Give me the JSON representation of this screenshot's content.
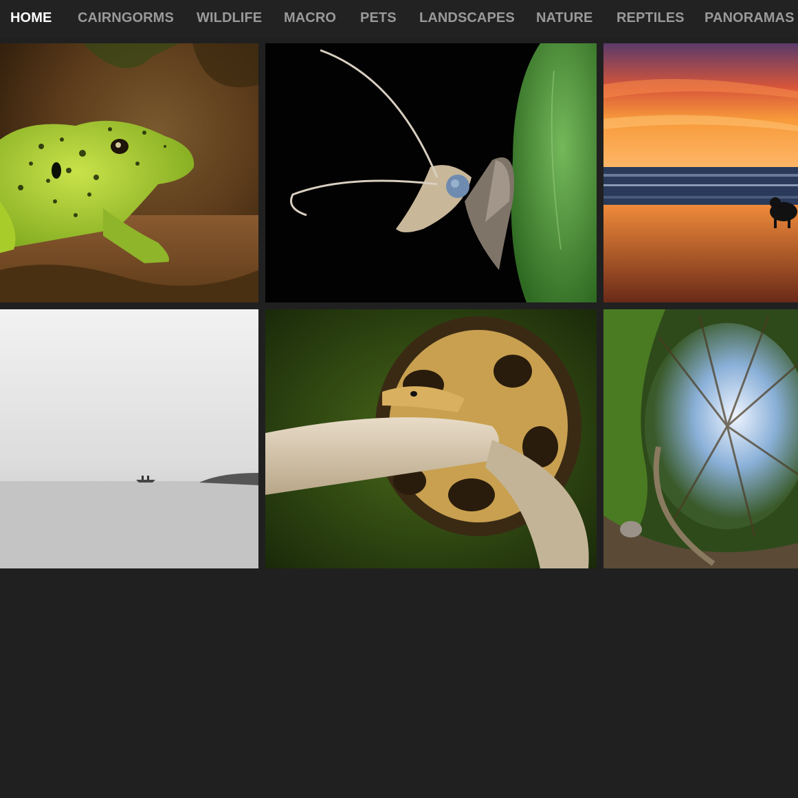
{
  "nav": {
    "items": [
      {
        "label": "HOME",
        "active": true
      },
      {
        "label": "CAIRNGORMS",
        "active": false
      },
      {
        "label": "WILDLIFE",
        "active": false
      },
      {
        "label": "MACRO",
        "active": false
      },
      {
        "label": "PETS",
        "active": false
      },
      {
        "label": "LANDSCAPES",
        "active": false
      },
      {
        "label": "NATURE",
        "active": false
      },
      {
        "label": "REPTILES",
        "active": false
      },
      {
        "label": "PANORAMAS",
        "active": false
      }
    ]
  },
  "gallery": {
    "tiles": [
      {
        "subject": "green lizard"
      },
      {
        "subject": "moth beside leaf"
      },
      {
        "subject": "sunset beach with dog"
      },
      {
        "subject": "misty loch with boat"
      },
      {
        "subject": "ball python on branch"
      },
      {
        "subject": "tiny planet forest"
      }
    ]
  },
  "colors": {
    "background": "#202020",
    "nav_background": "#222222",
    "nav_text": "#9a9a9a",
    "nav_active": "#ffffff"
  }
}
